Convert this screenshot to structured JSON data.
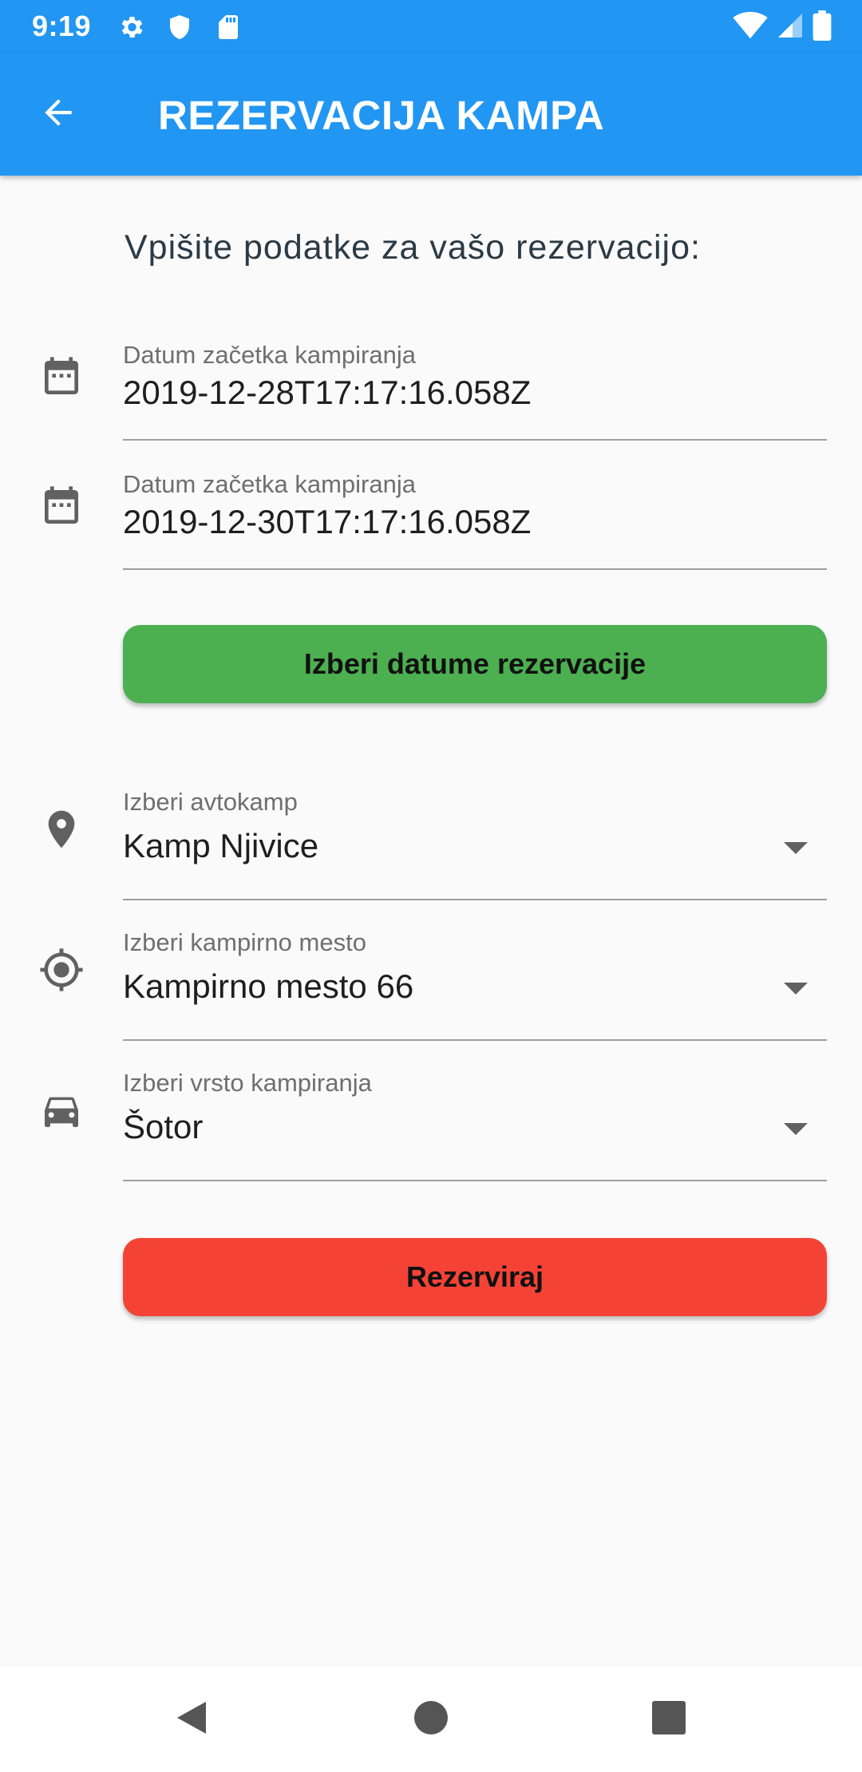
{
  "status_bar": {
    "time": "9:19",
    "icons": [
      "settings-icon",
      "shield-icon",
      "sd-card-icon",
      "wifi-icon",
      "signal-icon",
      "battery-icon"
    ]
  },
  "app_bar": {
    "title": "REZERVACIJA KAMPA",
    "back_icon": "arrow-back-icon"
  },
  "form": {
    "intro": "Vpišite podatke za vašo rezervacijo:",
    "start_date": {
      "label": "Datum začetka kampiranja",
      "value": "2019-12-28T17:17:16.058Z",
      "icon": "calendar-icon"
    },
    "end_date": {
      "label": "Datum začetka kampiranja",
      "value": "2019-12-30T17:17:16.058Z",
      "icon": "calendar-icon"
    },
    "pick_dates_button": "Izberi datume rezervacije",
    "autocamp": {
      "label": "Izberi avtokamp",
      "value": "Kamp Njivice",
      "icon": "location-pin-icon"
    },
    "camp_spot": {
      "label": "Izberi kampirno mesto",
      "value": "Kampirno mesto 66",
      "icon": "gps-target-icon"
    },
    "camp_type": {
      "label": "Izberi vrsto kampiranja",
      "value": "Šotor",
      "icon": "car-icon"
    },
    "reserve_button": "Rezerviraj"
  },
  "colors": {
    "primary": "#2196f3",
    "green_button": "#4caf50",
    "red_button": "#f44336",
    "background": "#fafafa"
  },
  "nav_bar": {
    "icons": [
      "back-triangle-icon",
      "home-circle-icon",
      "recents-square-icon"
    ]
  }
}
